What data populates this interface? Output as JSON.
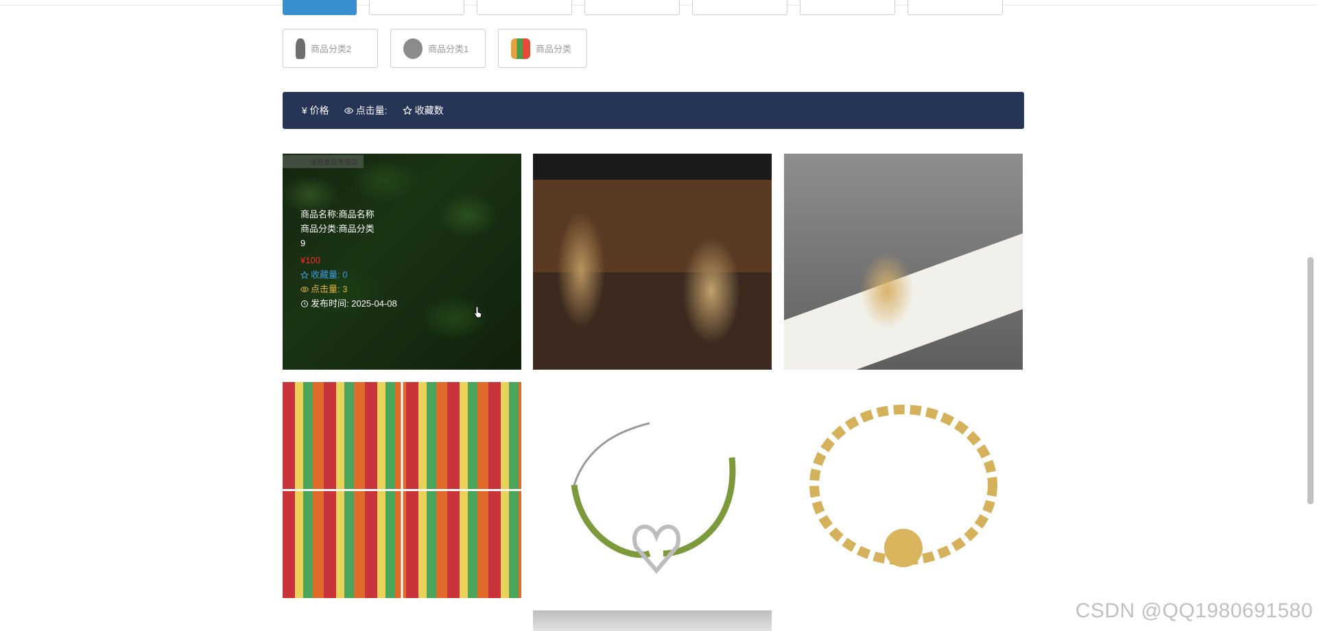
{
  "categories": {
    "row2": [
      {
        "label": "商品分类2",
        "icon": "dress-thumbnail"
      },
      {
        "label": "商品分类1",
        "icon": "product-thumbnail"
      },
      {
        "label": "商品分类",
        "icon": "bottles-thumbnail"
      }
    ]
  },
  "sortbar": {
    "price": "¥ 价格",
    "clicks": "点击量:",
    "favorites": "收藏数"
  },
  "products": [
    {
      "shop_tag": "淡宛食品专营店",
      "name": "商品名称:商品名称",
      "category": "商品分类:商品分类",
      "count": "9",
      "price": "¥100",
      "favorites": "收藏量: 0",
      "clicks": "点击量: 3",
      "published": "发布时间: 2025-04-08"
    }
  ],
  "watermark": "CSDN @QQ1980691580",
  "colors": {
    "sortbar_bg": "#263456",
    "active_chip": "#3a8fd1",
    "price": "#ff2a2a"
  }
}
